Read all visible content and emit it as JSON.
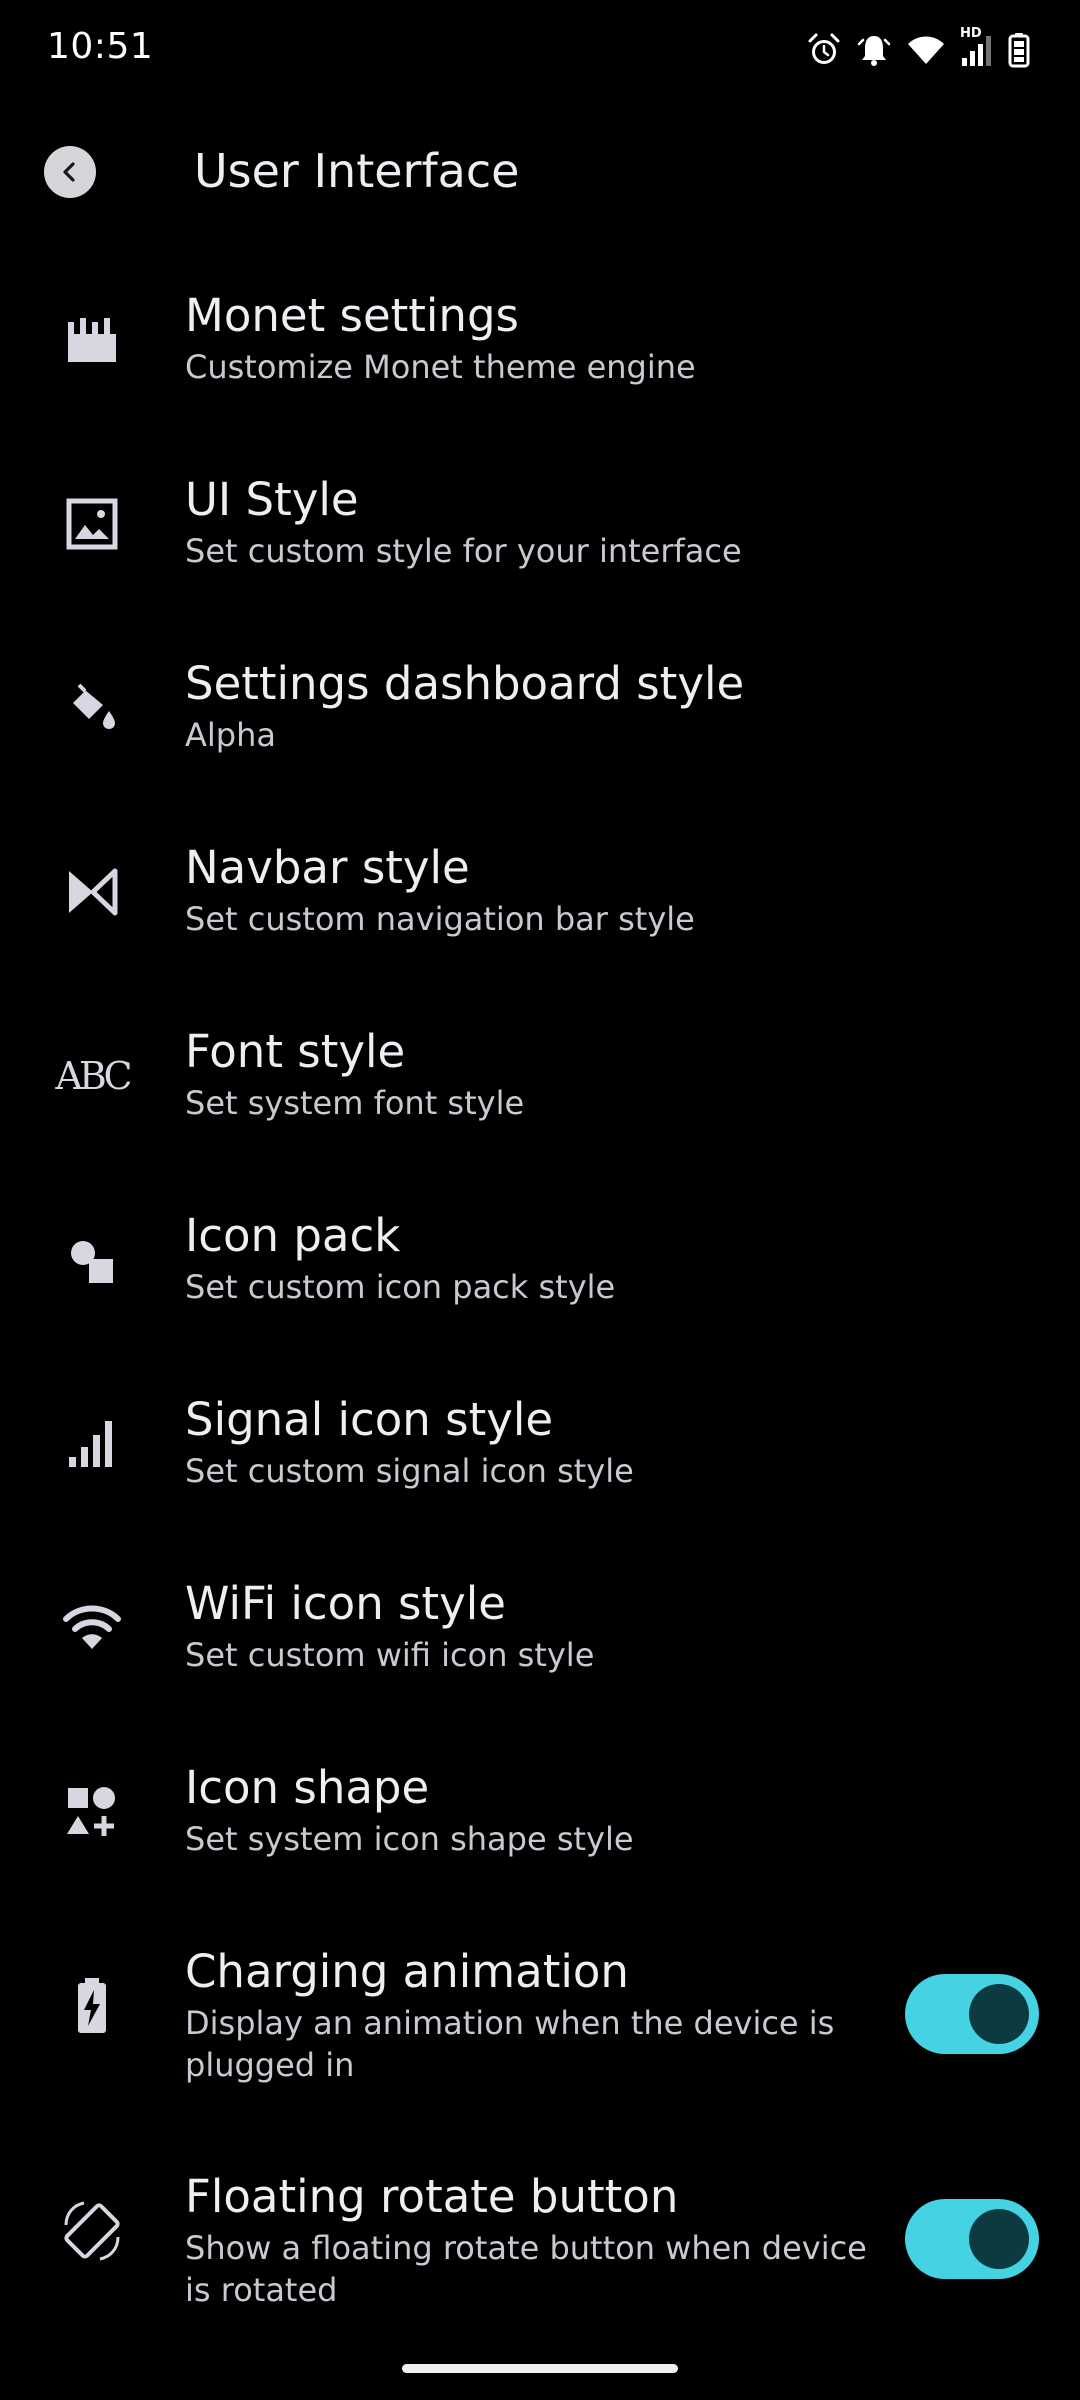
{
  "status_bar": {
    "time": "10:51",
    "icons": [
      "alarm-icon",
      "notification-bell-icon",
      "wifi-icon",
      "hd-signal-icon",
      "battery-icon"
    ],
    "hd_label": "HD"
  },
  "header": {
    "title": "User Interface",
    "back_icon": "back-arrow-icon"
  },
  "settings": [
    {
      "icon": "monet-icon",
      "title": "Monet settings",
      "summary": "Customize Monet theme engine"
    },
    {
      "icon": "ui-style-icon",
      "title": "UI Style",
      "summary": "Set custom style for your interface"
    },
    {
      "icon": "paint-bucket-icon",
      "title": "Settings dashboard style",
      "summary": "Alpha"
    },
    {
      "icon": "navbar-icon",
      "title": "Navbar style",
      "summary": "Set custom navigation bar style"
    },
    {
      "icon": "font-icon",
      "title": "Font style",
      "summary": "Set system font style",
      "icon_text": "ABC"
    },
    {
      "icon": "shapes-icon",
      "title": "Icon pack",
      "summary": "Set custom icon pack style"
    },
    {
      "icon": "signal-icon",
      "title": "Signal icon style",
      "summary": "Set custom signal icon style"
    },
    {
      "icon": "wifi-icon",
      "title": "WiFi icon style",
      "summary": "Set custom wifi icon style"
    },
    {
      "icon": "icon-shape-icon",
      "title": "Icon shape",
      "summary": "Set system icon shape style"
    },
    {
      "icon": "battery-charging-icon",
      "title": "Charging animation",
      "summary": "Display an animation when the device is plugged in",
      "toggle": true
    },
    {
      "icon": "screen-rotation-icon",
      "title": "Floating rotate button",
      "summary": "Show a floating rotate button when device is rotated",
      "toggle": true
    }
  ],
  "colors": {
    "background": "#000000",
    "toggle_track": "#45D2E3",
    "toggle_thumb": "#0B3B40",
    "text_primary": "#EEEEF3",
    "text_secondary": "#C9C9D2"
  }
}
